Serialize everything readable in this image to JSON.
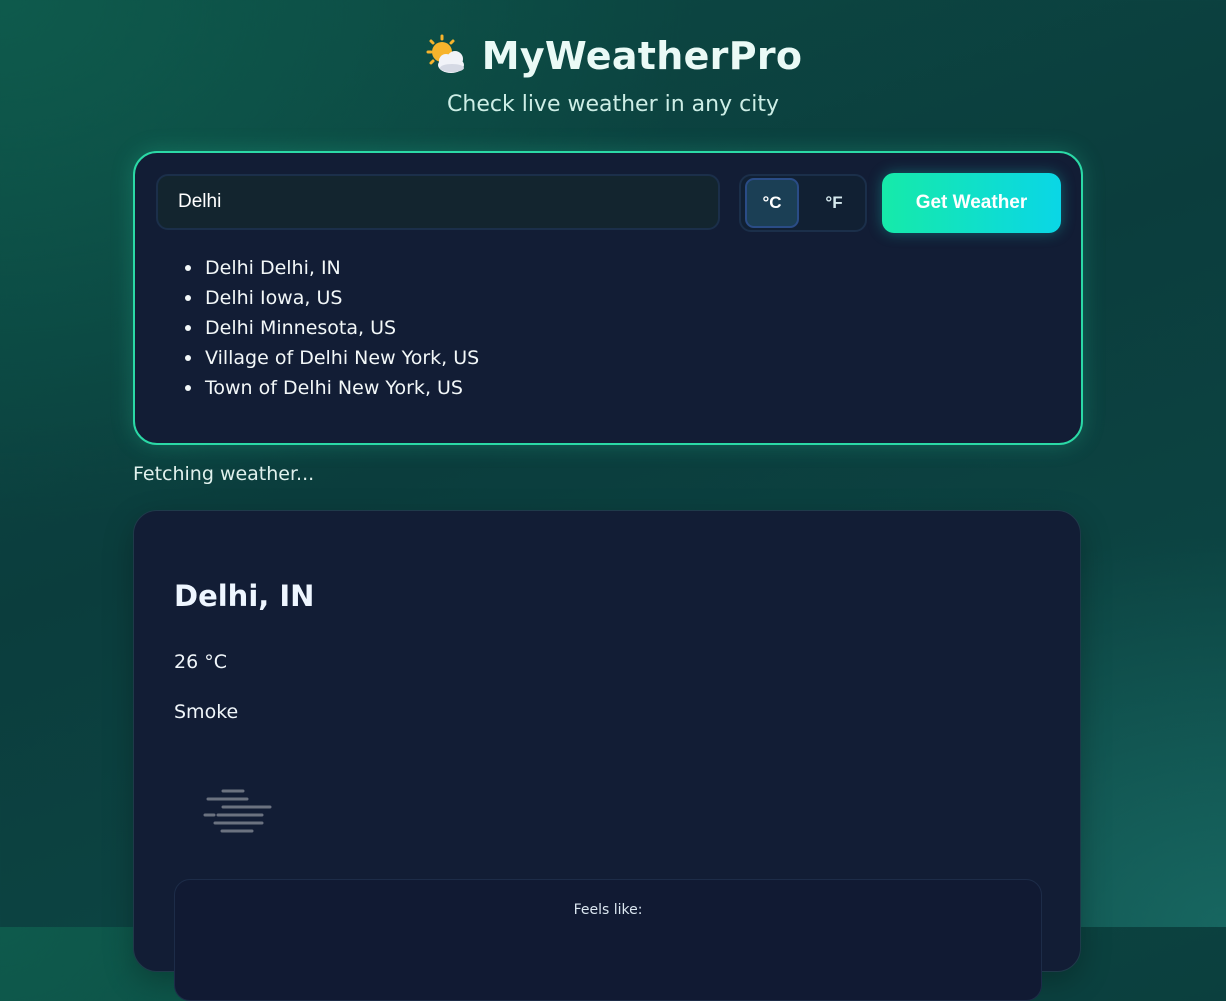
{
  "app": {
    "title": "MyWeatherPro",
    "subtitle": "Check live weather in any city",
    "logo_icon": "sun-behind-cloud-icon"
  },
  "search": {
    "value": "Delhi",
    "placeholder": "",
    "units": {
      "celsius_label": "°C",
      "fahrenheit_label": "°F",
      "selected": "°C"
    },
    "button_label": "Get Weather",
    "suggestions": [
      "Delhi Delhi, IN",
      "Delhi Iowa, US",
      "Delhi Minnesota, US",
      "Village of Delhi New York, US",
      "Town of Delhi New York, US"
    ]
  },
  "status": "Fetching weather...",
  "weather": {
    "city": "Delhi, IN",
    "temperature": "26 °C",
    "condition": "Smoke",
    "condition_icon": "smoke-icon",
    "feels_like_label": "Feels like:"
  },
  "colors": {
    "accent": "#2bd9a6",
    "button_gradient_start": "#16eaa9",
    "button_gradient_end": "#0ad6e6",
    "card_bg": "#121d35",
    "page_bg": "#0b3d3d"
  }
}
